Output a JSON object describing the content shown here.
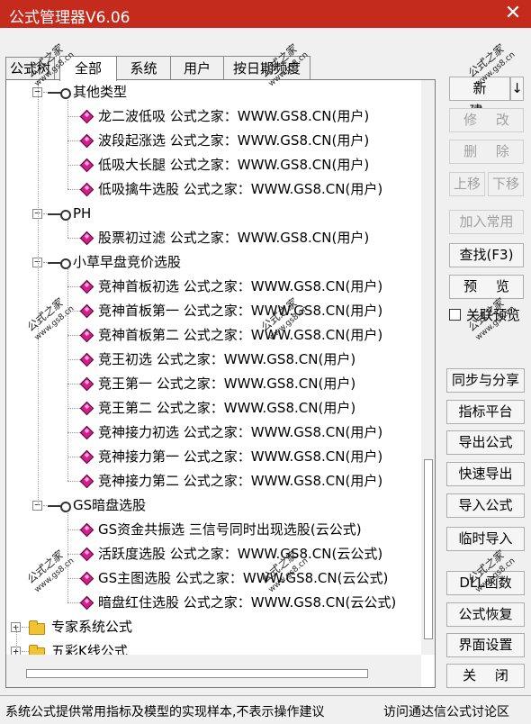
{
  "window": {
    "title": "公式管理器V6.06",
    "close_label": "✕"
  },
  "outer_tab": "公式树",
  "tabs": [
    "全部",
    "系统",
    "用户",
    "按日期频度"
  ],
  "tree": {
    "groups": [
      {
        "label": "其他类型",
        "items": [
          "龙二波低吸 公式之家：WWW.GS8.CN(用户)",
          "波段起涨选 公式之家：WWW.GS8.CN(用户)",
          "低吸大长腿 公式之家：WWW.GS8.CN(用户)",
          "低吸擒牛选股 公式之家：WWW.GS8.CN(用户)"
        ]
      },
      {
        "label": "PH",
        "items": [
          "股票初过滤 公式之家：WWW.GS8.CN(用户)"
        ]
      },
      {
        "label": "小草早盘竞价选股",
        "items": [
          "竞神首板初选 公式之家：WWW.GS8.CN(用户)",
          "竞神首板第一 公式之家：WWW.GS8.CN(用户)",
          "竞神首板第二 公式之家：WWW.GS8.CN(用户)",
          "竞王初选 公式之家：WWW.GS8.CN(用户)",
          "竞王第一 公式之家：WWW.GS8.CN(用户)",
          "竞王第二 公式之家：WWW.GS8.CN(用户)",
          "竞神接力初选 公式之家：WWW.GS8.CN(用户)",
          "竞神接力第一 公式之家：WWW.GS8.CN(用户)",
          "竞神接力第二 公式之家：WWW.GS8.CN(用户)"
        ]
      },
      {
        "label": "GS暗盘选股",
        "items": [
          "GS资金共振选 三信号同时出现选股(云公式)",
          "活跃度选股 公式之家：WWW.GS8.CN(云公式)",
          "GS主图选股 公式之家：WWW.GS8.CN(云公式)",
          "暗盘红住选股 公式之家：WWW.GS8.CN(云公式)"
        ]
      }
    ],
    "folders": [
      "专家系统公式",
      "五彩K线公式"
    ],
    "expander_open": "−",
    "expander_closed": "+"
  },
  "buttons": {
    "new": "新 建",
    "new_arrow": "↓",
    "modify": "修 改",
    "delete": "删 除",
    "move_up": "上移",
    "move_down": "下移",
    "add_common": "加入常用",
    "find": "查找(F3)",
    "preview": "预 览",
    "link_preview": "关联预览",
    "sync_share": "同步与分享",
    "indicator_platform": "指标平台",
    "export": "导出公式",
    "quick_export": "快速导出",
    "import": "导入公式",
    "temp_import": "临时导入",
    "dll": "DLL函数",
    "restore": "公式恢复",
    "ui_settings": "界面设置",
    "close": "关 闭"
  },
  "status": {
    "text": "系统公式提供常用指标及模型的实现样本,不表示操作建议",
    "link": "访问通达信公式讨论区"
  },
  "watermark": {
    "title": "公式之家",
    "url": "www.gs8.cn"
  }
}
